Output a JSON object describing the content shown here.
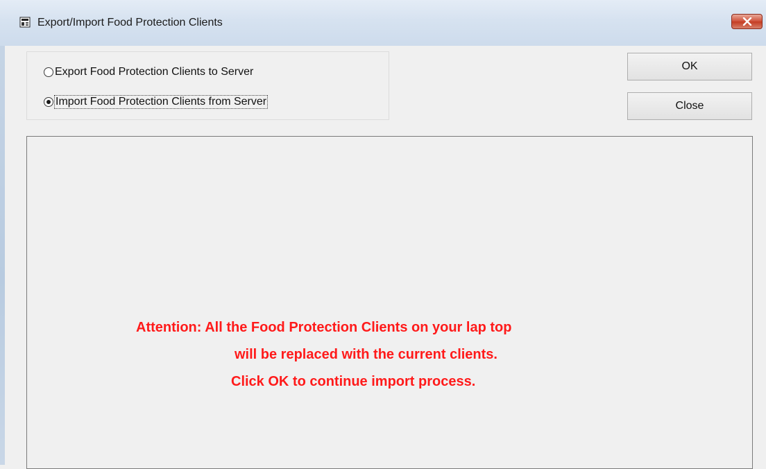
{
  "window": {
    "title": "Export/Import Food Protection Clients",
    "icon": "app-document-icon",
    "close_icon": "close-x-icon"
  },
  "options": {
    "export_label": "Export Food Protection Clients to Server",
    "import_label": "Import Food Protection Clients from Server",
    "selected": "import"
  },
  "buttons": {
    "ok_label": "OK",
    "close_label": "Close"
  },
  "message": {
    "color": "#ff1a1a",
    "lines": [
      "Attention:  All the Food Protection Clients on your lap top",
      "will be replaced with the current clients.",
      "Click OK to continue import process."
    ]
  }
}
